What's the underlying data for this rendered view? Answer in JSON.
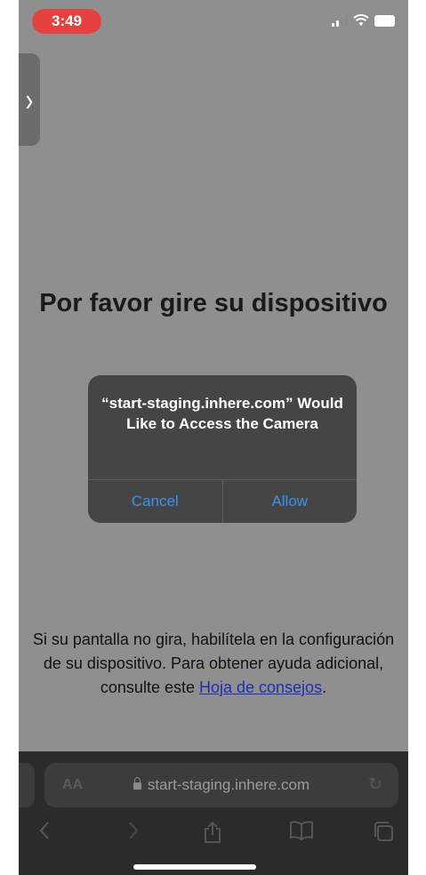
{
  "status_bar": {
    "time": "3:49"
  },
  "page": {
    "title": "Por favor gire su dispositivo",
    "help_text": "Si su pantalla no gira, habilítela en la configuración de su dispositivo. Para obtener ayuda adicional, consulte este ",
    "help_link": "Hoja de consejos",
    "help_end": "."
  },
  "dialog": {
    "message": "“start-staging.inhere.com” Would Like to Access the Camera",
    "cancel_label": "Cancel",
    "allow_label": "Allow"
  },
  "browser": {
    "aa_label": "AA",
    "url": "start-staging.inhere.com"
  },
  "colors": {
    "accent": "#3f8ef0",
    "time_pill": "#e5423f",
    "link": "#1b2fb8"
  },
  "icons": [
    "side-panel-chevron-icon",
    "signal-icon",
    "wifi-icon",
    "battery-icon",
    "lock-icon",
    "reload-icon",
    "back-icon",
    "forward-icon",
    "share-icon",
    "bookmarks-icon",
    "tabs-icon"
  ]
}
